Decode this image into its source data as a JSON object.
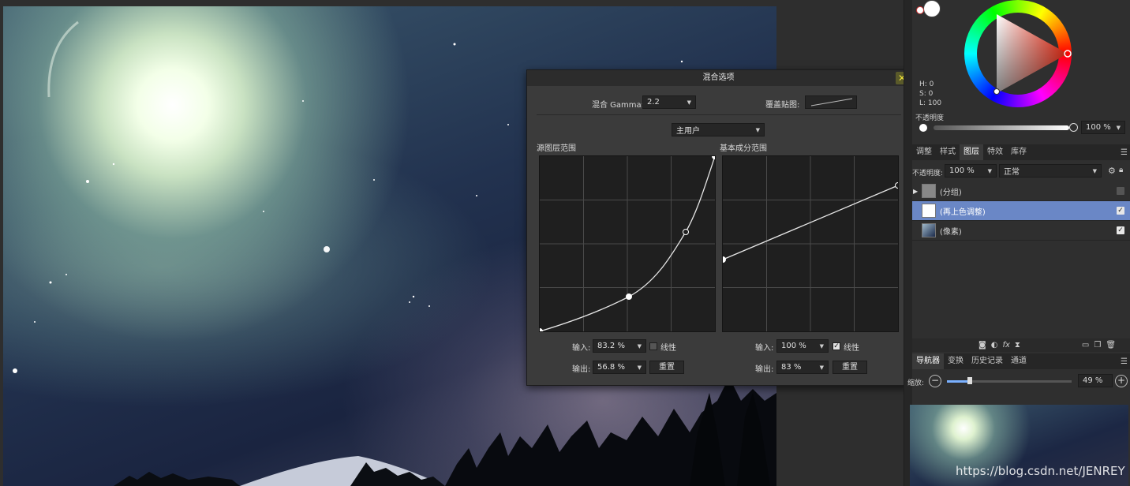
{
  "dialog": {
    "title": "混合选项",
    "gamma_label": "混合 Gamma:",
    "gamma_value": "2.2",
    "overlay_label": "覆盖贴图:",
    "channel_value": "主用户",
    "source_title": "源图层范围",
    "underlying_title": "基本成分范围",
    "input_label": "输入:",
    "output_label": "输出:",
    "linear_label": "线性",
    "reset_label": "重置",
    "source": {
      "input": "83.2 %",
      "output": "56.8 %",
      "linear": false
    },
    "underlying": {
      "input": "100 %",
      "output": "83 %",
      "linear": true
    }
  },
  "color": {
    "h": "H: 0",
    "s": "S: 0",
    "l": "L: 100",
    "opacity_label": "不透明度",
    "opacity_value": "100 %"
  },
  "layers_tabs": [
    "调整",
    "样式",
    "图层",
    "特效",
    "库存"
  ],
  "layers_active_tab": "图层",
  "layers_toolbar": {
    "opacity_label": "不透明度:",
    "opacity_value": "100 %",
    "blend_mode": "正常"
  },
  "layers": [
    {
      "name": "(分组)",
      "selected": false,
      "checked": false
    },
    {
      "name": "(再上色调整)",
      "selected": true,
      "checked": true
    },
    {
      "name": "(像素)",
      "selected": false,
      "checked": true
    }
  ],
  "nav_tabs": [
    "导航器",
    "变换",
    "历史记录",
    "通道"
  ],
  "nav_active_tab": "导航器",
  "navigator": {
    "zoom_label": "缩放:",
    "zoom_value": "49 %"
  },
  "watermark": "https://blog.csdn.net/JENREY",
  "colors": {
    "selection": "#6a87c6",
    "close": "#f3e63a"
  }
}
